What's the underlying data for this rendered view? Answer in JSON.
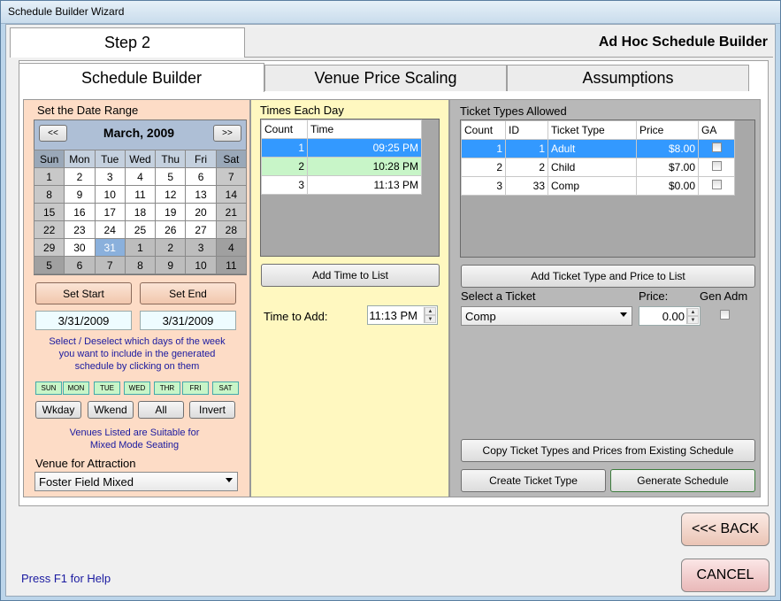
{
  "window": {
    "title": "Schedule Builder Wizard"
  },
  "header": {
    "step": "Step 2",
    "subtitle": "Ad Hoc Schedule Builder"
  },
  "tabs": [
    "Schedule Builder",
    "Venue Price Scaling",
    "Assumptions"
  ],
  "date_panel": {
    "title": "Set the Date Range",
    "prev": "<<",
    "next": ">>",
    "month": "March, 2009",
    "weekdays": [
      "Sun",
      "Mon",
      "Tue",
      "Wed",
      "Thu",
      "Fri",
      "Sat"
    ],
    "weeks": [
      [
        "1",
        "2",
        "3",
        "4",
        "5",
        "6",
        "7"
      ],
      [
        "8",
        "9",
        "10",
        "11",
        "12",
        "13",
        "14"
      ],
      [
        "15",
        "16",
        "17",
        "18",
        "19",
        "20",
        "21"
      ],
      [
        "22",
        "23",
        "24",
        "25",
        "26",
        "27",
        "28"
      ],
      [
        "29",
        "30",
        "31",
        "1",
        "2",
        "3",
        "4"
      ],
      [
        "5",
        "6",
        "7",
        "8",
        "9",
        "10",
        "11"
      ]
    ],
    "selected_day": "31",
    "set_start": "Set Start",
    "set_end": "Set End",
    "start_date": "3/31/2009",
    "end_date": "3/31/2009",
    "instructions": "Select / Deselect which days of the week you want to include in the generated schedule by clicking on them",
    "day_toggles": [
      "SUN",
      "MON",
      "TUE",
      "WED",
      "THR",
      "FRI",
      "SAT"
    ],
    "wkday": "Wkday",
    "wkend": "Wkend",
    "all": "All",
    "invert": "Invert",
    "venues_note": "Venues Listed are Suitable for Mixed Mode Seating",
    "venue_label": "Venue for Attraction",
    "venue_value": "Foster Field Mixed"
  },
  "times_panel": {
    "title": "Times Each Day",
    "columns": [
      "Count",
      "Time"
    ],
    "rows": [
      [
        "1",
        "09:25 PM"
      ],
      [
        "2",
        "10:28 PM"
      ],
      [
        "3",
        "11:13 PM"
      ]
    ],
    "add_button": "Add Time to List",
    "time_label": "Time to Add:",
    "time_value": "11:13 PM"
  },
  "tickets_panel": {
    "title": "Ticket Types Allowed",
    "columns": [
      "Count",
      "ID",
      "Ticket Type",
      "Price",
      "GA"
    ],
    "rows": [
      [
        "1",
        "1",
        "Adult",
        "$8.00"
      ],
      [
        "2",
        "2",
        "Child",
        "$7.00"
      ],
      [
        "3",
        "33",
        "Comp",
        "$0.00"
      ]
    ],
    "add_button": "Add Ticket Type and Price to List",
    "select_label": "Select a Ticket",
    "price_label": "Price:",
    "genadm_label": "Gen Adm",
    "select_value": "Comp",
    "price_value": "0.00",
    "copy_button": "Copy Ticket Types and Prices from Existing Schedule",
    "create_button": "Create Ticket Type",
    "generate_button": "Generate Schedule"
  },
  "footer": {
    "back": "<<< BACK",
    "cancel": "CANCEL",
    "help": "Press F1 for Help"
  },
  "colors": {
    "peach": "#fddcc6",
    "yellow": "#fff8c0",
    "gray": "#b8b8b8",
    "blue_select": "#3399ff",
    "green_row": "#c8f5c8"
  }
}
